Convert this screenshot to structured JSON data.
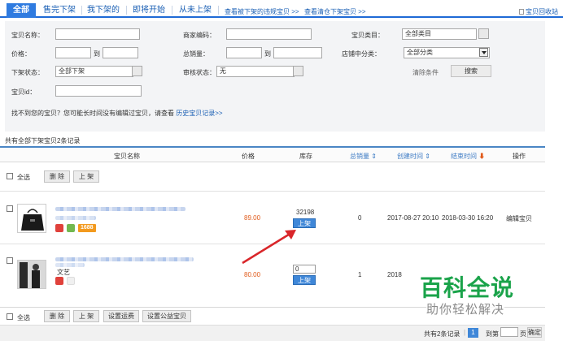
{
  "tabs": [
    {
      "label": "全部",
      "active": true
    },
    {
      "label": "售完下架",
      "active": false
    },
    {
      "label": "我下架的",
      "active": false
    },
    {
      "label": "即将开始",
      "active": false
    },
    {
      "label": "从未上架",
      "active": false
    }
  ],
  "top_links": {
    "violation": "查看被下架的违规宝贝 >>",
    "clean": "查看清仓下架宝贝 >>",
    "recycle": "宝贝回收站"
  },
  "filters": {
    "name_label": "宝贝名称：",
    "code_label": "商家编码：",
    "category_label": "宝贝类目：",
    "category_value": "全部类目",
    "price_label": "价格：",
    "to1": "到",
    "sales_label": "总销量：",
    "to2": "到",
    "shop_cat_label": "店铺中分类：",
    "shop_cat_value": "全部分类",
    "status_label": "下架状态：",
    "status_value": "全部下架",
    "audit_label": "审核状态：",
    "audit_value": "无",
    "clear_label": "清除条件",
    "search_label": "搜索",
    "id_label": "宝贝id：",
    "hint_text": "找不到您的宝贝？您可能长时间没有编辑过宝贝，请查看",
    "hint_link": "历史宝贝记录>>"
  },
  "table": {
    "count_text": "共有全部下架宝贝2条记录",
    "headers": {
      "name": "宝贝名称",
      "price": "价格",
      "stock": "库存",
      "sales": "总销量",
      "created": "创建时间",
      "end": "结束时间",
      "action": "操作"
    },
    "select_all": "全选",
    "delete": "删 除",
    "list_up": "上 架",
    "rows": [
      {
        "price": "89.00",
        "stock": "32198",
        "up_btn": "上架",
        "sales": "0",
        "created": "2017-08-27 20:10",
        "end": "2018-03-30 16:20",
        "action": "编辑宝贝",
        "badge": "1688"
      },
      {
        "price": "80.00",
        "stock": "0",
        "up_btn": "上架",
        "sales": "1",
        "created": "2018",
        "shop_tag": "文艺"
      }
    ]
  },
  "bottom": {
    "select_all": "全选",
    "delete": "删 除",
    "list_up": "上 架",
    "set_shipping": "设置运费",
    "set_charity": "设置公益宝贝"
  },
  "pagination": {
    "total": "共有2条记录",
    "current": "1",
    "goto": "到第",
    "page": "页",
    "confirm": "确定"
  },
  "watermark": {
    "title": "百科全说",
    "subtitle": "助你轻松解决"
  },
  "colors": {
    "accent": "#2f7be0",
    "price": "#e05a1a",
    "arrow": "#d9262a",
    "watermark": "#1aa34a"
  }
}
